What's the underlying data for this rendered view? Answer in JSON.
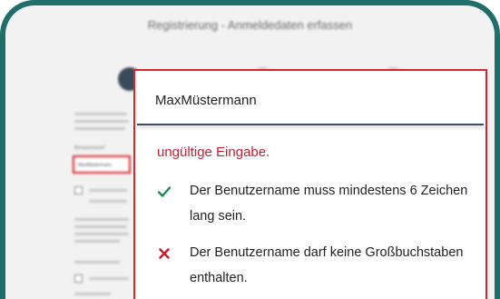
{
  "page": {
    "title": "Registrierung - Anmeldedaten erfassen"
  },
  "colors": {
    "frame": "#1f6e6a",
    "error": "#c81e32",
    "valid": "#1f8a4c",
    "invalid": "#c81e32",
    "input_underline": "#3c4e61"
  },
  "form": {
    "username_label": "Benutzername*",
    "username_value_bg": "MaxMüstermann"
  },
  "popup": {
    "input_value": "MaxMüstermann",
    "error_message": "ungültige Eingabe.",
    "rules": [
      {
        "status": "valid",
        "icon": "check-icon",
        "text": "Der Benutzername muss mindestens 6 Zeichen lang sein."
      },
      {
        "status": "invalid",
        "icon": "cross-icon",
        "text": "Der Benutzername darf keine Großbuchstaben enthalten."
      }
    ]
  }
}
